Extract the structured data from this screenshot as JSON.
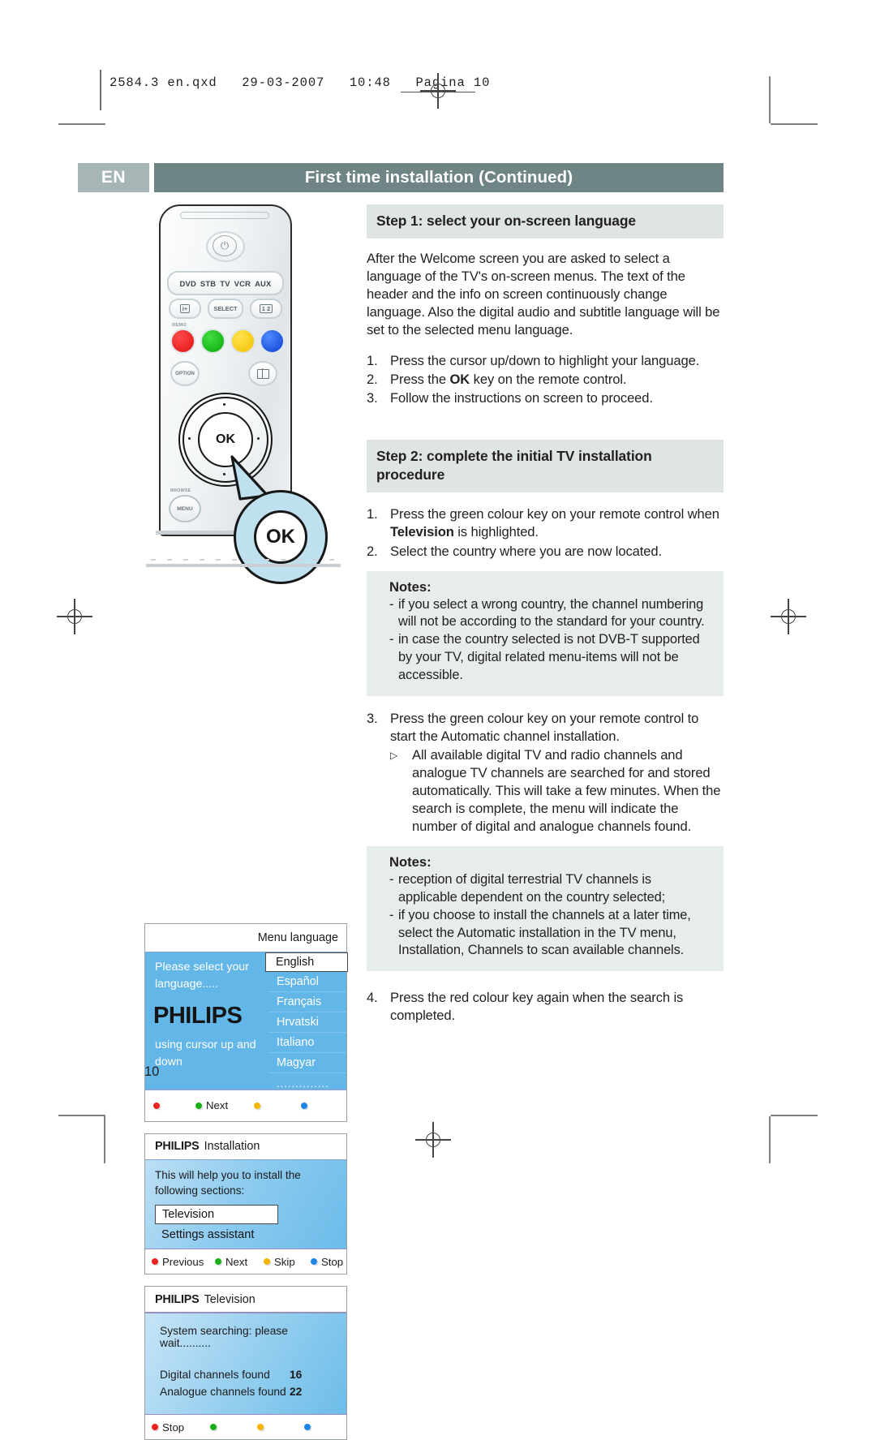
{
  "print_header": {
    "text": "2584.3 en.qxd   29-03-2007   10:48   Pagina 10"
  },
  "titlebar": {
    "language_code": "EN",
    "title": "First time installation  (Continued)"
  },
  "step1": {
    "heading": "Step 1: select your on-screen language",
    "paragraph": "After the Welcome screen you are asked to select a language of the TV's on-screen menus. The text of the header and the info on screen continuously change language. Also the digital audio and subtitle language will be set to the selected menu language.",
    "items": [
      {
        "n": "1.",
        "text": "Press the cursor up/down to highlight your language."
      },
      {
        "n": "2.",
        "text": "Press the OK key on the remote control."
      },
      {
        "n": "3.",
        "text": "Follow the instructions on screen to proceed."
      }
    ]
  },
  "step2": {
    "heading": "Step 2: complete the initial TV installation procedure",
    "item1_n": "1.",
    "item1_text": "Press the green colour key on your remote control when Television is highlighted.",
    "item2_n": "2.",
    "item2_text": "Select the country where you are now located.",
    "notes1": {
      "title": "Notes:",
      "items": [
        "if you select a wrong country, the channel numbering will not be according to the standard for your country.",
        "in case the country selected is not DVB-T supported by your TV,  digital related menu-items will not be accessible."
      ]
    },
    "item3_n": "3.",
    "item3_text": "Press the green colour key on your remote control to start the Automatic channel installation.",
    "item3_bullet_glyph": "▷",
    "item3_bullet_text": "All available digital TV and radio channels and analogue TV channels  are searched for and stored automatically. This will take a few minutes. When the search is complete, the menu will indicate the number of digital and analogue channels found.",
    "notes2": {
      "title": "Notes:",
      "items": [
        "reception of digital terrestrial TV channels is applicable dependent on the country selected;",
        "if you choose to install the channels at a later time, select the Automatic installation in the TV menu, Installation, Channels to scan available channels."
      ]
    },
    "item4_n": "4.",
    "item4_text": "Press the red colour key again when the search is completed."
  },
  "remote": {
    "power_glyph": "⏻",
    "modes": [
      "DVD",
      "STB",
      "TV",
      "VCR",
      "AUX"
    ],
    "info_button": "i+",
    "select_button": "SELECT",
    "dual_button": "1 2",
    "demo_label": "DEMO",
    "option_button": "OPTION",
    "ok_label": "OK",
    "browse_label": "BROWSE",
    "menu_button": "MENU",
    "callout_label": "OK"
  },
  "tv_language_screen": {
    "title": "Menu language",
    "left_text_top": "Please select your language.....",
    "brand": "PHILIPS",
    "left_text_bottom": "using cursor up and down",
    "languages": [
      {
        "label": "English",
        "selected": true
      },
      {
        "label": "Español",
        "selected": false
      },
      {
        "label": "Français",
        "selected": false
      },
      {
        "label": "Hrvatski",
        "selected": false
      },
      {
        "label": "Italiano",
        "selected": false
      },
      {
        "label": "Magyar",
        "selected": false
      }
    ],
    "more_indicator": "..............",
    "footer": [
      {
        "colour": "r",
        "label": ""
      },
      {
        "colour": "g",
        "label": "Next"
      },
      {
        "colour": "y",
        "label": ""
      },
      {
        "colour": "b",
        "label": ""
      }
    ]
  },
  "tv_installation_screen": {
    "brand": "PHILIPS",
    "title": "Installation",
    "paragraph": "This will help you to install the following sections:",
    "selected_item": "Television",
    "other_item": "Settings assistant",
    "footer": [
      {
        "colour": "r",
        "label": "Previous"
      },
      {
        "colour": "g",
        "label": "Next"
      },
      {
        "colour": "y",
        "label": "Skip"
      },
      {
        "colour": "b",
        "label": "Stop"
      }
    ]
  },
  "tv_television_screen": {
    "brand": "PHILIPS",
    "title": "Television",
    "status": "System searching: please wait..........",
    "rows": [
      {
        "label": "Digital channels found",
        "value": "16"
      },
      {
        "label": "Analogue channels found",
        "value": "22"
      }
    ],
    "footer": [
      {
        "colour": "r",
        "label": "Stop"
      },
      {
        "colour": "g",
        "label": ""
      },
      {
        "colour": "y",
        "label": ""
      },
      {
        "colour": "b",
        "label": ""
      }
    ]
  },
  "page_number": "10"
}
